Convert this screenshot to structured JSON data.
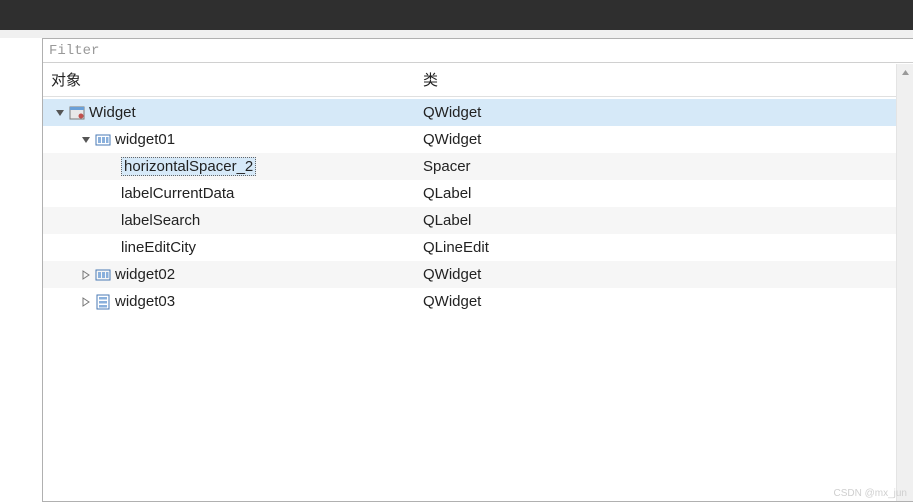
{
  "filter": {
    "placeholder": "Filter"
  },
  "headers": {
    "object": "对象",
    "class": "类"
  },
  "tree": {
    "r0": {
      "name": "Widget",
      "cls": "QWidget"
    },
    "r1": {
      "name": "widget01",
      "cls": "QWidget"
    },
    "r2": {
      "name": "horizontalSpacer_2",
      "cls": "Spacer"
    },
    "r3": {
      "name": "labelCurrentData",
      "cls": "QLabel"
    },
    "r4": {
      "name": "labelSearch",
      "cls": "QLabel"
    },
    "r5": {
      "name": "lineEditCity",
      "cls": "QLineEdit"
    },
    "r6": {
      "name": "widget02",
      "cls": "QWidget"
    },
    "r7": {
      "name": "widget03",
      "cls": "QWidget"
    }
  },
  "watermark": "CSDN @mx_jun"
}
